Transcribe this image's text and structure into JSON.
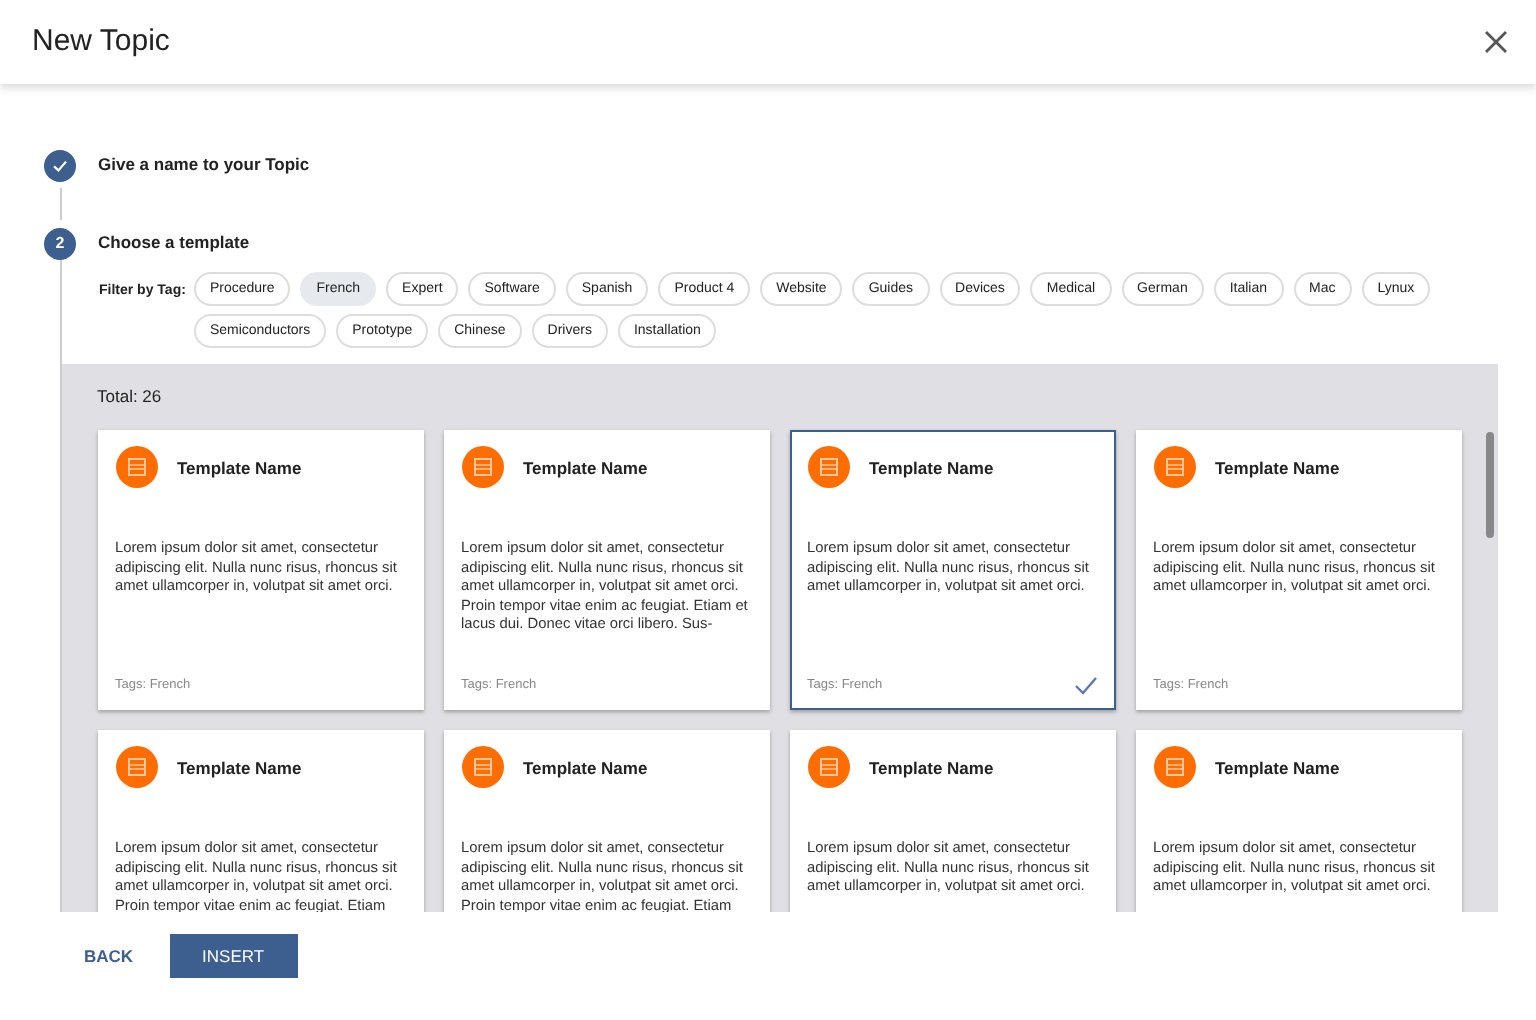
{
  "dialog": {
    "title": "New Topic"
  },
  "steps": [
    {
      "label": "Give a name to your Topic",
      "done": true
    },
    {
      "number": "2",
      "label": "Choose a template",
      "done": false
    }
  ],
  "filter": {
    "label": "Filter by Tag:",
    "tags": [
      {
        "label": "Procedure",
        "selected": false
      },
      {
        "label": "French",
        "selected": true
      },
      {
        "label": "Expert",
        "selected": false
      },
      {
        "label": "Software",
        "selected": false
      },
      {
        "label": "Spanish",
        "selected": false
      },
      {
        "label": "Product 4",
        "selected": false
      },
      {
        "label": "Website",
        "selected": false
      },
      {
        "label": "Guides",
        "selected": false
      },
      {
        "label": "Devices",
        "selected": false
      },
      {
        "label": "Medical",
        "selected": false
      },
      {
        "label": "German",
        "selected": false
      },
      {
        "label": "Italian",
        "selected": false
      },
      {
        "label": "Mac",
        "selected": false
      },
      {
        "label": "Lynux",
        "selected": false
      },
      {
        "label": "Semiconductors",
        "selected": false
      },
      {
        "label": "Prototype",
        "selected": false
      },
      {
        "label": "Chinese",
        "selected": false
      },
      {
        "label": "Drivers",
        "selected": false
      },
      {
        "label": "Installation",
        "selected": false
      }
    ]
  },
  "total": "Total: 26",
  "templates": [
    {
      "name": "Template Name",
      "description": "Lorem ipsum dolor sit amet, consectetur adipiscing elit. Nulla nunc risus, rhoncus sit amet ullamcorper in, volutpat sit amet orci.",
      "tags": "Tags: French",
      "selected": false
    },
    {
      "name": "Template Name",
      "description": "Lorem ipsum dolor sit amet, consectetur adipiscing elit. Nulla nunc risus, rhoncus sit amet ullamcorper in, volutpat sit amet orci. Proin tempor vitae enim ac feugiat. Etiam et lacus dui. Donec vitae orci libero. Sus-",
      "tags": "Tags: French",
      "selected": false
    },
    {
      "name": "Template Name",
      "description": "Lorem ipsum dolor sit amet, consectetur adipiscing elit. Nulla nunc risus, rhoncus sit amet ullamcorper in, volutpat sit amet orci.",
      "tags": "Tags: French",
      "selected": true
    },
    {
      "name": "Template Name",
      "description": "Lorem ipsum dolor sit amet, consectetur adipiscing elit. Nulla nunc risus, rhoncus sit amet ullamcorper in, volutpat sit amet orci.",
      "tags": "Tags: French",
      "selected": false
    },
    {
      "name": "Template Name",
      "description": "Lorem ipsum dolor sit amet, consectetur adipiscing elit. Nulla nunc risus, rhoncus sit amet ullamcorper in, volutpat sit amet orci. Proin tempor vitae enim ac feugiat. Etiam",
      "selected": false
    },
    {
      "name": "Template Name",
      "description": "Lorem ipsum dolor sit amet, consectetur adipiscing elit. Nulla nunc risus, rhoncus sit amet ullamcorper in, volutpat sit amet orci. Proin tempor vitae enim ac feugiat. Etiam",
      "selected": false
    },
    {
      "name": "Template Name",
      "description": "Lorem ipsum dolor sit amet, consectetur adipiscing elit. Nulla nunc risus, rhoncus sit amet ullamcorper in, volutpat sit amet orci.",
      "selected": false
    },
    {
      "name": "Template Name",
      "description": "Lorem ipsum dolor sit amet, consectetur adipiscing elit. Nulla nunc risus, rhoncus sit amet ullamcorper in, volutpat sit amet orci.",
      "selected": false
    }
  ],
  "buttons": [
    {
      "label": "BACK",
      "kind": "text"
    },
    {
      "label": "INSERT",
      "kind": "primary"
    }
  ]
}
